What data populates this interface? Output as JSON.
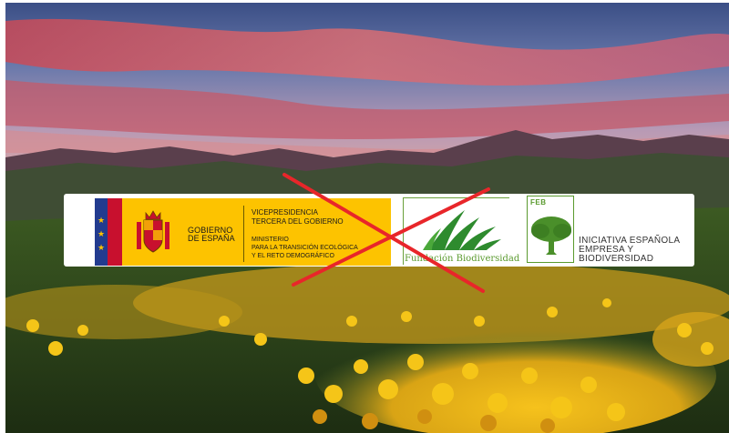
{
  "government": {
    "name": "GOBIERNO\nDE ESPAÑA",
    "vicepresidency": "VICEPRESIDENCIA\nTERCERA DEL GOBIERNO",
    "ministry": "MINISTERIO\nPARA LA TRANSICIÓN ECOLÓGICA\nY EL RETO DEMOGRÁFICO"
  },
  "fundacion": {
    "label": "Fundación Biodiversidad"
  },
  "ieeb": {
    "code": "FEB",
    "text": "INICIATIVA ESPAÑOLA\nEMPRESA Y\nBIODIVERSIDAD"
  },
  "icons": [
    "spain-coat-of-arms-icon",
    "grass-icon",
    "tree-icon",
    "red-cross-mark-icon"
  ],
  "colors": {
    "gov_yellow": "#fdc300",
    "flag_blue": "#223b8f",
    "flag_red": "#c8102e",
    "brand_green": "#5a9a2e",
    "cross_red": "#e8262a"
  }
}
